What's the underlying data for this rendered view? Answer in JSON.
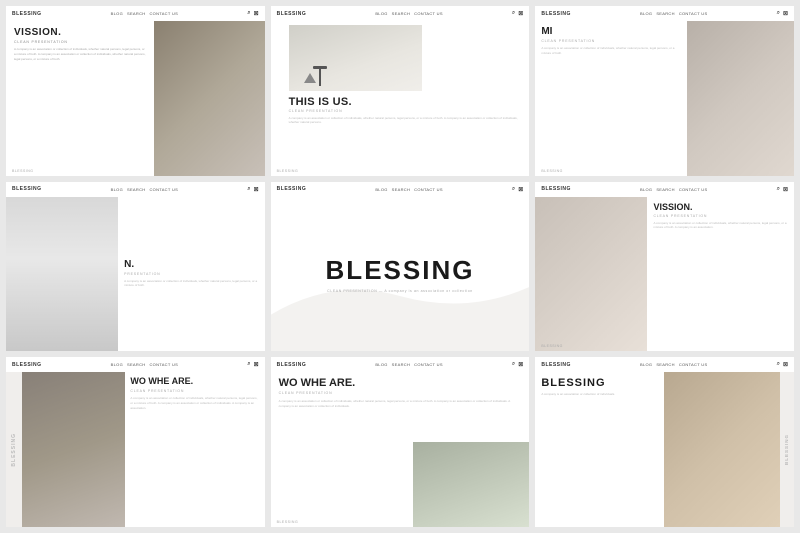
{
  "slides": [
    {
      "id": "slide-1",
      "nav": {
        "brand": "BLESSING",
        "links": [
          "BLOG",
          "SEARCH",
          "CONTACT US"
        ],
        "icons": [
          "🔍",
          "🛒"
        ]
      },
      "title": "VISSION.",
      "subtitle": "CLEAN PRESENTATION",
      "body": "A company is an association or collection of individuals, whether natural persons, legal persons, or a mixture of both. A company is an association or collection of individuals, whether natural persons, legal persons, or a mixture of both.",
      "bottom_label": "BLESSING",
      "photo_type": "office_meeting"
    },
    {
      "id": "slide-2",
      "nav": {
        "brand": "BLESSING",
        "links": [
          "BLOG",
          "SEARCH",
          "CONTACT US"
        ],
        "icons": [
          "🔍",
          "🛒"
        ]
      },
      "title": "THIS IS US.",
      "subtitle": "CLEAN PRESENTATION",
      "body": "A company is an association or collection of individuals, whether natural persons, legal persons, or a mixture of both. A company is an association or collection of individuals, whether natural persons.",
      "bottom_label": "BLESSING",
      "photo_type": "desk_lamp"
    },
    {
      "id": "slide-3",
      "nav": {
        "brand": "BLESSING",
        "links": [
          "BLOG",
          "SEARCH",
          "CONTACT US"
        ],
        "icons": [
          "🔍",
          "🛒"
        ]
      },
      "title": "MI",
      "subtitle": "CLEAN PRESENTATION",
      "body": "A company is an association or collection of individuals, whether natural persons, legal persons, or a mixture of both.",
      "bottom_label": "BLESSING",
      "photo_type": "hands_writing"
    },
    {
      "id": "slide-4",
      "nav": {
        "brand": "BLESSING",
        "links": [
          "BLOG",
          "SEARCH",
          "CONTACT US"
        ],
        "icons": [
          "🔍",
          "🛒"
        ]
      },
      "title": "N.",
      "full_title": "N.",
      "subtitle": "PRESENTATION",
      "body": "A company is an association or collection of individuals, whether natural persons, legal persons, or a mixture of both.",
      "bottom_label": "",
      "photo_type": "office_space"
    },
    {
      "id": "slide-5",
      "nav": {
        "brand": "BLESSING",
        "links": [
          "BLOG",
          "SEARCH",
          "CONTACT US"
        ],
        "icons": [
          "🔍",
          "🛒"
        ]
      },
      "title": "BLESSING",
      "subtitle": "CLEAN PRESENTATION — A company is an association or collection",
      "photo_type": "curve_bg"
    },
    {
      "id": "slide-6",
      "nav": {
        "brand": "BLESSING",
        "links": [
          "BLOG",
          "SEARCH",
          "CONTACT US"
        ],
        "icons": [
          "🔍",
          "🛒"
        ]
      },
      "title": "VISSION.",
      "subtitle": "CLEAN PRESENTATION",
      "body": "A company is an association or collection of individuals, whether natural persons, legal persons, or a mixture of both. A company is an association.",
      "bottom_label": "BLESSING",
      "photo_type": "team_meeting"
    },
    {
      "id": "slide-7",
      "nav": {
        "brand": "BLESSING",
        "links": [
          "BLOG",
          "SEARCH",
          "CONTACT US"
        ],
        "icons": [
          "🔍",
          "🛒"
        ]
      },
      "title": "WO WHE ARE.",
      "subtitle": "CLEAN PRESENTATION",
      "body": "A company is an association or collection of individuals, whether natural persons, legal persons, or a mixture of both. A company is an association or collection of individuals. A company is an association.",
      "vertical_label": "BLESSING",
      "photo_type": "woman_black"
    },
    {
      "id": "slide-8",
      "nav": {
        "brand": "BLESSING",
        "links": [
          "BLOG",
          "SEARCH",
          "CONTACT US"
        ],
        "icons": [
          "🔍",
          "🛒"
        ]
      },
      "title": "WO WHE ARE.",
      "subtitle": "CLEAN PRESENTATION",
      "body": "A company is an association or collection of individuals, whether natural persons, legal persons, or a mixture of both. A company is an association or collection of individuals. A company is an association or collection of individuals.",
      "bottom_label": "BLESSING",
      "photo_type": "woman_standing"
    },
    {
      "id": "slide-9",
      "nav": {
        "brand": "BLESSING",
        "links": [
          "BLOG",
          "SEARCH",
          "CONTACT US"
        ],
        "icons": [
          "🔍",
          "🛒"
        ]
      },
      "title": "BLESSING",
      "subtitle": "A company is an association or collection of individuals.",
      "vertical_label": "BLESSING",
      "photo_type": "woman_desk"
    }
  ],
  "icons": {
    "search": "🔍",
    "cart": "🛒"
  }
}
